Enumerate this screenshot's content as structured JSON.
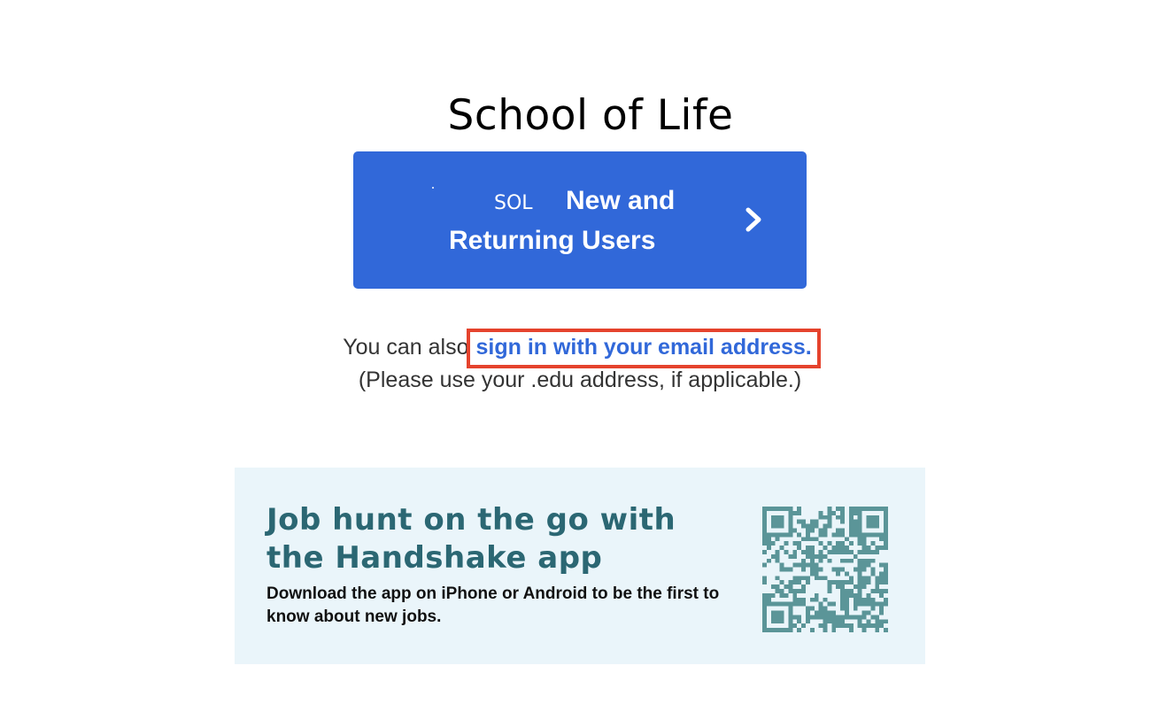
{
  "school": {
    "name": "School of Life"
  },
  "sso_button": {
    "abbrev": "SOL",
    "label": "New and Returning Users"
  },
  "alt_signin": {
    "prefix": "You can also",
    "link_text": "sign in with your email address.",
    "hint": "(Please use your .edu address, if applicable.)"
  },
  "app_promo": {
    "heading": "Job hunt on the go with the Handshake app",
    "description": "Download the app on iPhone or Android to be the first to know about new jobs.",
    "qr_icon": "qr-code-icon"
  },
  "colors": {
    "primary": "#3168d9",
    "highlight": "#e5432d",
    "promo_bg": "#eaf5fa",
    "promo_heading": "#2b6773",
    "qr": "#5b9598"
  }
}
